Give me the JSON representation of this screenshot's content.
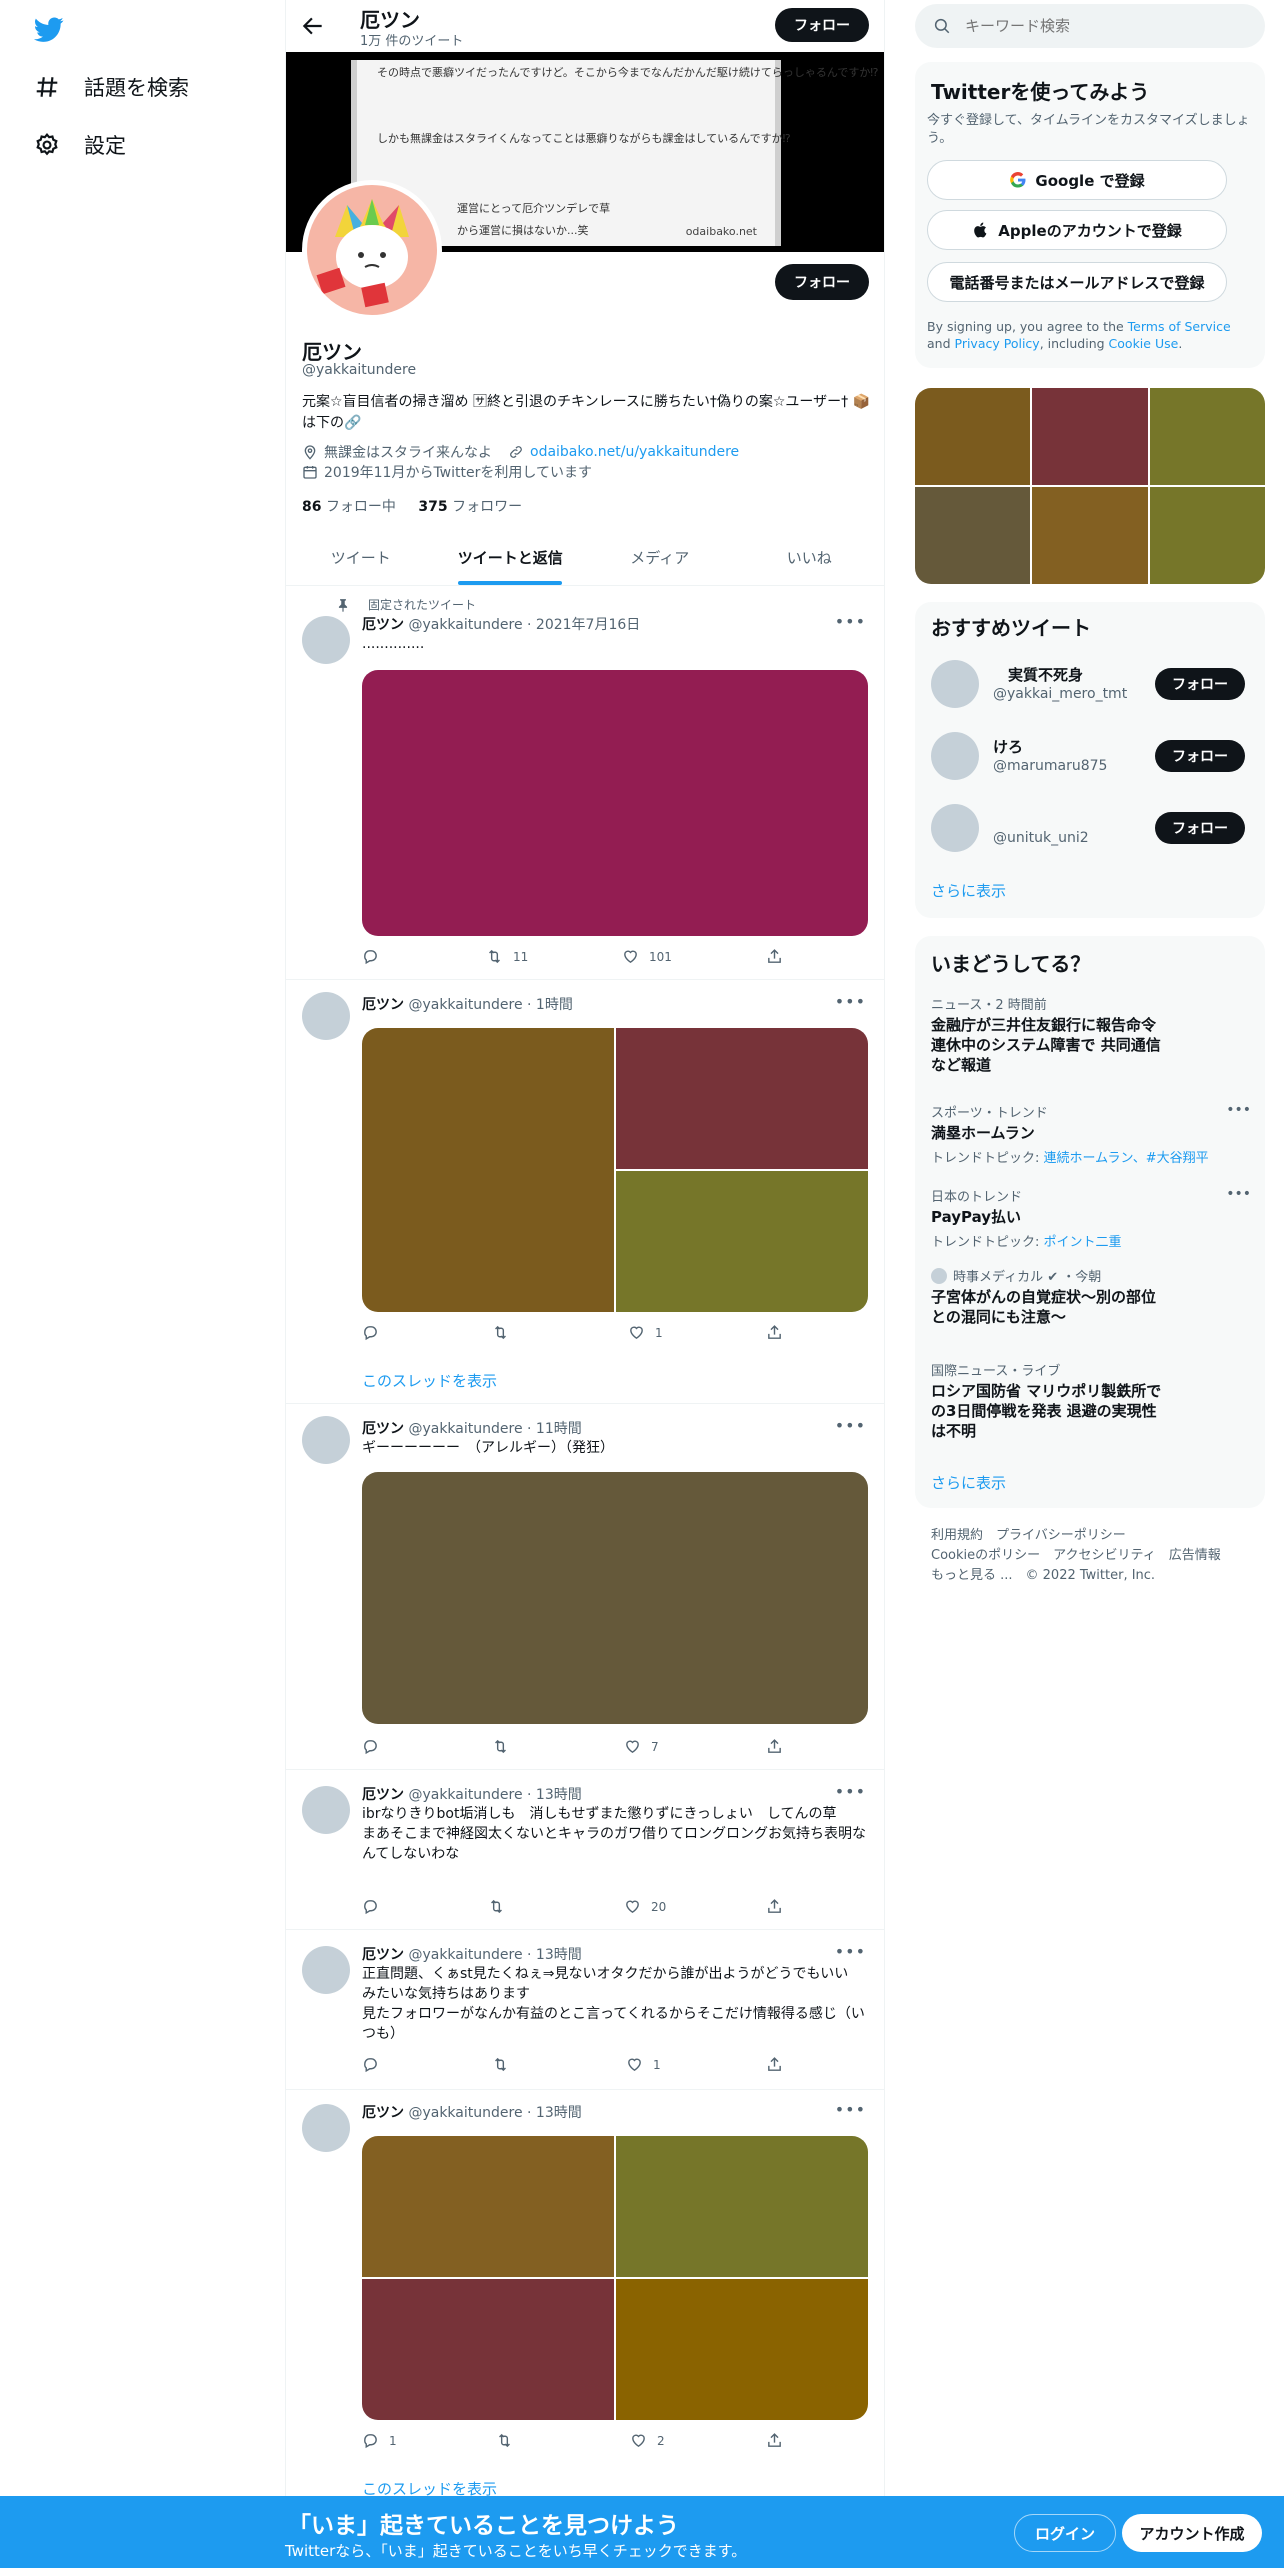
{
  "nav": {
    "explore_label": "話題を検索",
    "settings_label": "設定"
  },
  "header": {
    "name": "厄ツン",
    "tweet_count": "1万 件のツイート",
    "follow_label": "フォロー"
  },
  "banner": {
    "lines": [
      "その時点で悪癖ツイだったんですけど。そこから今までなんだかんだ駆け続けてらっしゃるんですか⁉",
      "しかも無課金はスタライくんなってことは悪癖りながらも課金はしているんですか⁉",
      "運営にとって厄介ツンデレで草",
      "から運営に損はないか...笑"
    ],
    "site": "odaibako.net"
  },
  "profile": {
    "follow_label": "フォロー",
    "name": "厄ツン",
    "handle": "@yakkaitundere",
    "bio": "元案☆盲目信者の掃き溜め 🈂終と引退のチキンレースに勝ちたい†偽りの案☆ユーザー† 📦は下の🔗",
    "location": "無課金はスタライ来んなよ",
    "url": "odaibako.net/u/yakkaitundere",
    "joined": "2019年11月からTwitterを利用しています",
    "following_count": "86",
    "following_label": "フォロー中",
    "followers_count": "375",
    "followers_label": "フォロワー"
  },
  "tabs": [
    "ツイート",
    "ツイートと返信",
    "メディア",
    "いいね"
  ],
  "pinned_label": "固定されたツイート",
  "thread_label": "このスレッドを表示",
  "tweets": [
    {
      "name": "厄ツン",
      "handle": "@yakkaitundere",
      "time": "2021年7月16日",
      "text": "..............",
      "reply": "",
      "retweet": "11",
      "like": "101"
    },
    {
      "name": "厄ツン",
      "handle": "@yakkaitundere",
      "time": "1時間",
      "text": "",
      "reply": "",
      "retweet": "",
      "like": "1"
    },
    {
      "name": "厄ツン",
      "handle": "@yakkaitundere",
      "time": "11時間",
      "text": "ギーーーーーー　（アレルギー）（発狂）",
      "reply": "",
      "retweet": "",
      "like": "7"
    },
    {
      "name": "厄ツン",
      "handle": "@yakkaitundere",
      "time": "13時間",
      "text": "ibrなりきりbot垢消しも　消しもせずまた懲りずにきっしょい　してんの草\nまあそこまで神経図太くないとキャラのガワ借りてロングロングお気持ち表明なんてしないわな",
      "reply": "",
      "retweet": "",
      "like": "20"
    },
    {
      "name": "厄ツン",
      "handle": "@yakkaitundere",
      "time": "13時間",
      "text": "正直問題、くぁst見たくねぇ⇒見ないオタクだから誰が出ようがどうでもいい　みたいな気持ちはあります\n見たフォロワーがなんか有益のとこ言ってくれるからそこだけ情報得る感じ（いつも）",
      "reply": "",
      "retweet": "",
      "like": "1"
    },
    {
      "name": "厄ツン",
      "handle": "@yakkaitundere",
      "time": "13時間",
      "text": "",
      "reply": "1",
      "retweet": "",
      "like": "2"
    }
  ],
  "colors": {
    "accent": "#1d9bf0",
    "media_magenta": "#931d52",
    "media_olive_brown": "#7b5b1e",
    "media_maroon": "#773339",
    "media_olive": "#767629",
    "media_dark_olive": "#65593a",
    "media_ochre": "#836022",
    "media_mustard": "#8a6300"
  },
  "sidebar": {
    "search_placeholder": "キーワード検索",
    "signup": {
      "title": "Twitterを使ってみよう",
      "subtitle": "今すぐ登録して、タイムラインをカスタマイズしましょう。",
      "google": "Google で登録",
      "apple": "Appleのアカウントで登録",
      "phone": "電話番号またはメールアドレスで登録",
      "legal_prefix": "By signing up, you agree to the ",
      "terms": "Terms of Service",
      "and": " and ",
      "privacy": "Privacy Policy",
      "including": ", including ",
      "cookie": "Cookie Use",
      "period": "."
    },
    "recommend": {
      "title": "おすすめツイート",
      "users": [
        {
          "name": "　実質不死身",
          "handle": "@yakkai_mero_tmt"
        },
        {
          "name": "けろ",
          "handle": "@marumaru875"
        },
        {
          "name": "",
          "handle": "@unituk_uni2"
        }
      ],
      "follow_label": "フォロー",
      "more": "さらに表示"
    },
    "trends": {
      "title": "いまどうしてる？",
      "items": [
        {
          "meta": "ニュース・2 時間前",
          "title": "金融庁が三井住友銀行に報告命令\n連休中のシステム障害で 共同通信など報道",
          "sub_label": "",
          "sub_links": ""
        },
        {
          "meta": "スポーツ・トレンド",
          "title": "満塁ホームラン",
          "sub_label": "トレンドトピック: ",
          "sub_links": "連続ホームラン、#大谷翔平"
        },
        {
          "meta": "日本のトレンド",
          "title": "PayPay払い",
          "sub_label": "トレンドトピック: ",
          "sub_links": "ポイント二重"
        },
        {
          "meta": "時事メディカル ✔ ・今朝",
          "title": "子宮体がんの自覚症状～別の部位との混同にも注意～",
          "sub_label": "",
          "sub_links": ""
        },
        {
          "meta": "国際ニュース・ライブ",
          "title": "ロシア国防省 マリウポリ製鉄所での3日間停戦を発表 退避の実現性は不明",
          "sub_label": "",
          "sub_links": ""
        }
      ],
      "more": "さらに表示"
    },
    "footer": {
      "line1": "利用規約　プライバシーポリシー",
      "line2": "Cookieのポリシー　アクセシビリティ　広告情報",
      "line3": "もっと見る ...　© 2022 Twitter, Inc."
    }
  },
  "bottom_bar": {
    "title": "「いま」起きていることを見つけよう",
    "subtitle": "Twitterなら、「いま」起きていることをいち早くチェックできます。",
    "login": "ログイン",
    "signup": "アカウント作成"
  }
}
